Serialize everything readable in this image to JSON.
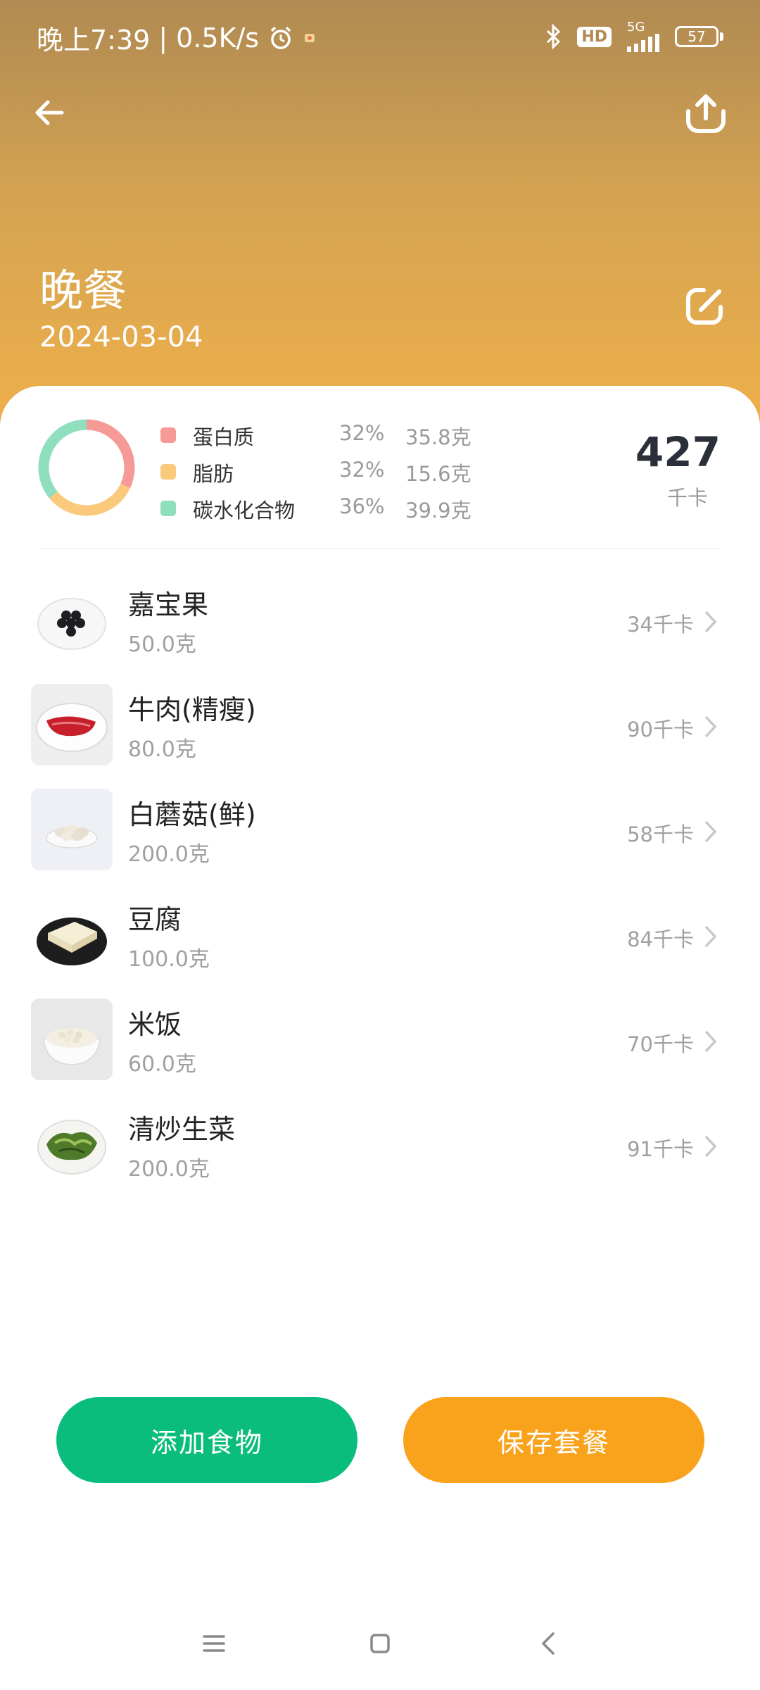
{
  "status_bar": {
    "time": "晚上7:39",
    "separator": "|",
    "net_speed": "0.5K/s",
    "network": "5G",
    "hd_label": "HD",
    "battery": "57",
    "icons": [
      "alarm-icon",
      "notification-icon",
      "bluetooth-icon",
      "hd-icon",
      "signal-icon",
      "battery-icon"
    ]
  },
  "header": {
    "title": "晚餐",
    "date": "2024-03-04",
    "back_icon": "back-arrow-icon",
    "share_icon": "share-upload-icon",
    "edit_icon": "edit-icon"
  },
  "summary": {
    "nutrients": [
      {
        "name": "蛋白质",
        "percent": "32%",
        "grams": "35.8克",
        "color": "#f59a96",
        "fraction": 0.32
      },
      {
        "name": "脂肪",
        "percent": "32%",
        "grams": "15.6克",
        "color": "#fbc97c",
        "fraction": 0.32
      },
      {
        "name": "碳水化合物",
        "percent": "36%",
        "grams": "39.9克",
        "color": "#8fdfbe",
        "fraction": 0.36
      }
    ],
    "total_kcal": "427",
    "kcal_unit": "千卡"
  },
  "foods": [
    {
      "name": "嘉宝果",
      "weight": "50.0克",
      "kcal": "34千卡",
      "image": "jaboticaba-plate"
    },
    {
      "name": "牛肉(精瘦)",
      "weight": "80.0克",
      "kcal": "90千卡",
      "image": "beef-plate"
    },
    {
      "name": "白蘑菇(鲜)",
      "weight": "200.0克",
      "kcal": "58千卡",
      "image": "mushroom-plate"
    },
    {
      "name": "豆腐",
      "weight": "100.0克",
      "kcal": "84千卡",
      "image": "tofu-plate"
    },
    {
      "name": "米饭",
      "weight": "60.0克",
      "kcal": "70千卡",
      "image": "rice-bowl"
    },
    {
      "name": "清炒生菜",
      "weight": "200.0克",
      "kcal": "91千卡",
      "image": "lettuce-plate"
    }
  ],
  "actions": {
    "add_food": "添加食物",
    "save_meal": "保存套餐"
  },
  "nav_bar": {
    "icons": [
      "menu-icon",
      "home-icon",
      "back-icon"
    ]
  },
  "colors": {
    "accent_green": "#0bbd7d",
    "accent_orange": "#f9a21b",
    "header_top": "#b08a52",
    "header_bottom": "#f0b04a"
  }
}
